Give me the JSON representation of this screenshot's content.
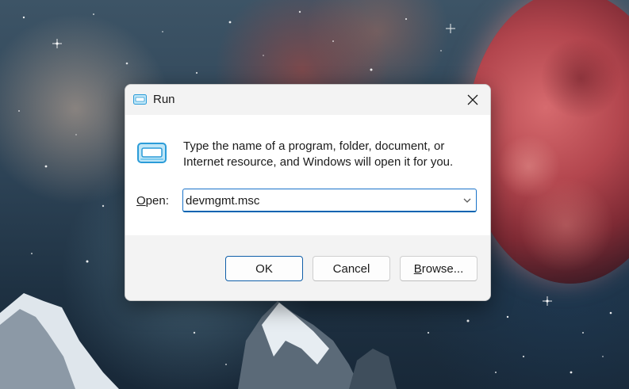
{
  "dialog": {
    "title": "Run",
    "description": "Type the name of a program, folder, document, or Internet resource, and Windows will open it for you.",
    "open_label_accel": "O",
    "open_label_rest": "pen:",
    "input_value": "devmgmt.msc",
    "buttons": {
      "ok": "OK",
      "cancel": "Cancel",
      "browse_accel": "B",
      "browse_rest": "rowse..."
    },
    "icons": {
      "title": "run-app-icon",
      "close": "close-icon",
      "main": "run-app-icon",
      "dropdown": "chevron-down-icon"
    }
  },
  "colors": {
    "focus_accent": "#0063b1",
    "icon_blue": "#2b9cd8"
  }
}
